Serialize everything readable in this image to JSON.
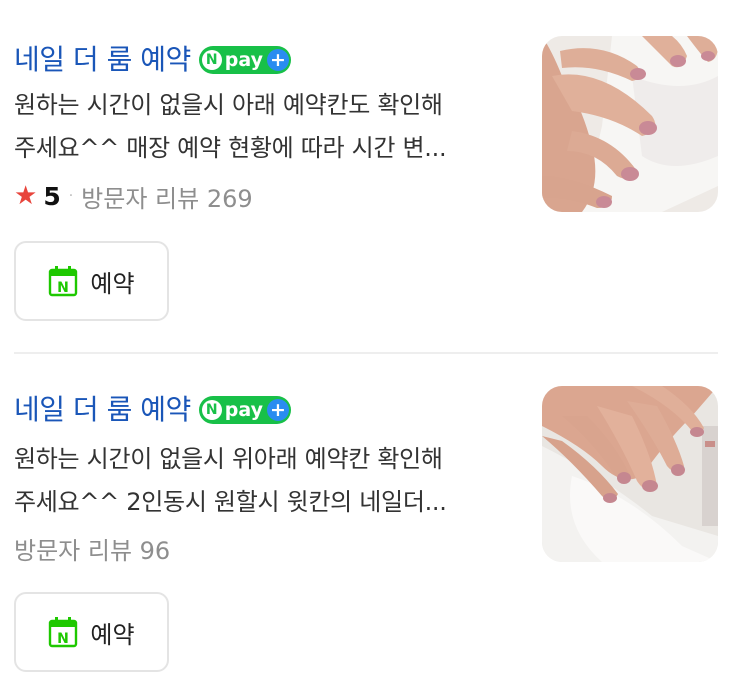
{
  "listings": [
    {
      "title": "네일 더 룸 예약",
      "npay": {
        "n": "N",
        "text": "pay",
        "plus": "+"
      },
      "description_line1": "원하는 시간이 없을시 아래 예약칸도 확인해",
      "description_line2": "주세요^^ 매장 예약 현황에 따라 시간 변...",
      "rating": "5",
      "rating_separator": "·",
      "reviews": "방문자 리뷰 269",
      "reserve_label": "예약"
    },
    {
      "title": "네일 더 룸 예약",
      "npay": {
        "n": "N",
        "text": "pay",
        "plus": "+"
      },
      "description_line1": "원하는 시간이 없을시 위아래 예약칸 확인해",
      "description_line2": "주세요^^ 2인동시 원할시 윗칸의 네일더...",
      "reviews": "방문자 리뷰 96",
      "reserve_label": "예약"
    }
  ],
  "colors": {
    "title": "#1a56b8",
    "npay_green": "#18c048",
    "npay_plus_blue": "#2a8cf0",
    "star": "#e8453c",
    "calendar_green": "#1ec800"
  },
  "icons": [
    "npay-badge-icon",
    "star-icon",
    "calendar-n-icon"
  ]
}
